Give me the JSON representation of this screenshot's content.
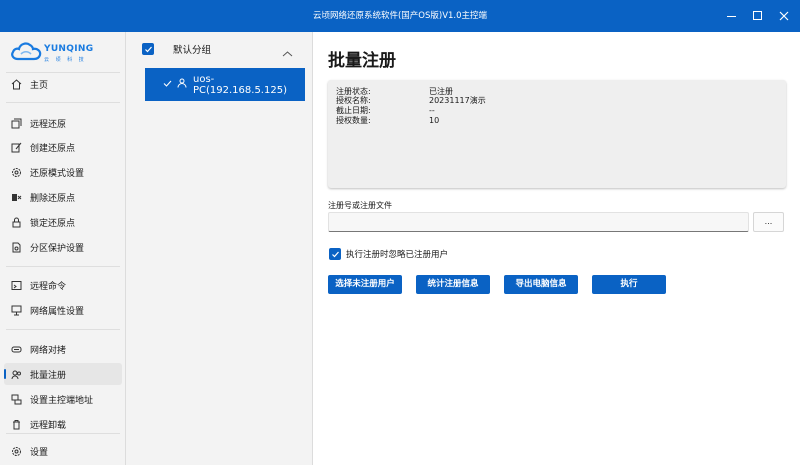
{
  "window": {
    "title": "云顷网络还原系统软件(国产OS版)V1.0主控端"
  },
  "logo": {
    "brand": "YUNQING",
    "brand_sub": "云 顷 科 技"
  },
  "sidebar": {
    "home": "主页",
    "restore": [
      {
        "label": "远程还原",
        "icon": "restore-icon"
      },
      {
        "label": "创建还原点",
        "icon": "edit-icon"
      },
      {
        "label": "还原模式设置",
        "icon": "settings-icon"
      },
      {
        "label": "删除还原点",
        "icon": "delete-point-icon"
      },
      {
        "label": "锁定还原点",
        "icon": "lock-icon"
      },
      {
        "label": "分区保护设置",
        "icon": "partition-icon"
      }
    ],
    "remote": [
      {
        "label": "远程命令",
        "icon": "terminal-icon"
      },
      {
        "label": "网络属性设置",
        "icon": "network-icon"
      }
    ],
    "tools": [
      {
        "label": "网络对拷",
        "icon": "copy-icon"
      },
      {
        "label": "批量注册",
        "icon": "users-icon",
        "active": true
      },
      {
        "label": "设置主控端地址",
        "icon": "address-icon"
      },
      {
        "label": "远程卸载",
        "icon": "uninstall-icon"
      }
    ],
    "settings": "设置"
  },
  "groups": {
    "group_name": "默认分组",
    "device_name": "uos-PC(192.168.5.125)"
  },
  "main": {
    "title": "批量注册",
    "info": {
      "status_label": "注册状态:",
      "status_value": "已注册",
      "name_label": "授权名称:",
      "name_value": "20231117演示",
      "expire_label": "截止日期:",
      "expire_value": "--",
      "count_label": "授权数量:",
      "count_value": "10"
    },
    "reg_field_label": "注册号或注册文件",
    "reg_field_value": "",
    "browse_label": "...",
    "ignore_label": "执行注册时忽略已注册用户",
    "buttons": {
      "select": "选择未注册用户",
      "stats": "统计注册信息",
      "export": "导出电脑信息",
      "execute": "执行"
    }
  },
  "colors": {
    "accent": "#0a62c4"
  }
}
